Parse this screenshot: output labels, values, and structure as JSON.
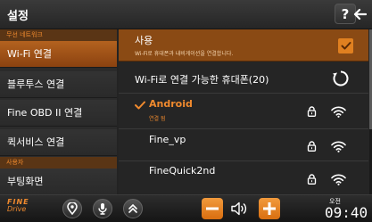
{
  "header": {
    "title": "설정",
    "help_label": "?",
    "back_label": "←"
  },
  "sidebar": {
    "sections": [
      {
        "label": "무선 네트워크"
      },
      {
        "label": "사용자"
      }
    ],
    "items": [
      {
        "label": "Wi-Fi 연결",
        "active": true
      },
      {
        "label": "블루투스 연결",
        "active": false
      },
      {
        "label": "Fine OBD II 연결",
        "active": false
      },
      {
        "label": "퀵서비스 연결",
        "active": false
      },
      {
        "label": "부팅화면",
        "active": false
      }
    ]
  },
  "main": {
    "use": {
      "label": "사용",
      "description": "Wi-Fi로 휴대폰과 내비게이션을 연결합니다.",
      "checked": true
    },
    "list_header": {
      "label": "Wi-Fi로 연결 가능한 휴대폰(20)"
    },
    "devices": [
      {
        "name": "Android",
        "status": "연결 됨",
        "connected": true
      },
      {
        "name": "Fine_vp",
        "status": "",
        "connected": false
      },
      {
        "name": "FineQuick2nd",
        "status": "",
        "connected": false
      }
    ]
  },
  "bottom": {
    "logo_top": "FINE",
    "logo_bottom": "Drive",
    "ampm": "오전",
    "time": "09:40"
  },
  "colors": {
    "accent": "#e08020",
    "active_bg": "#a05a1c",
    "section_bg": "#5a3515",
    "text": "#ffffff"
  }
}
